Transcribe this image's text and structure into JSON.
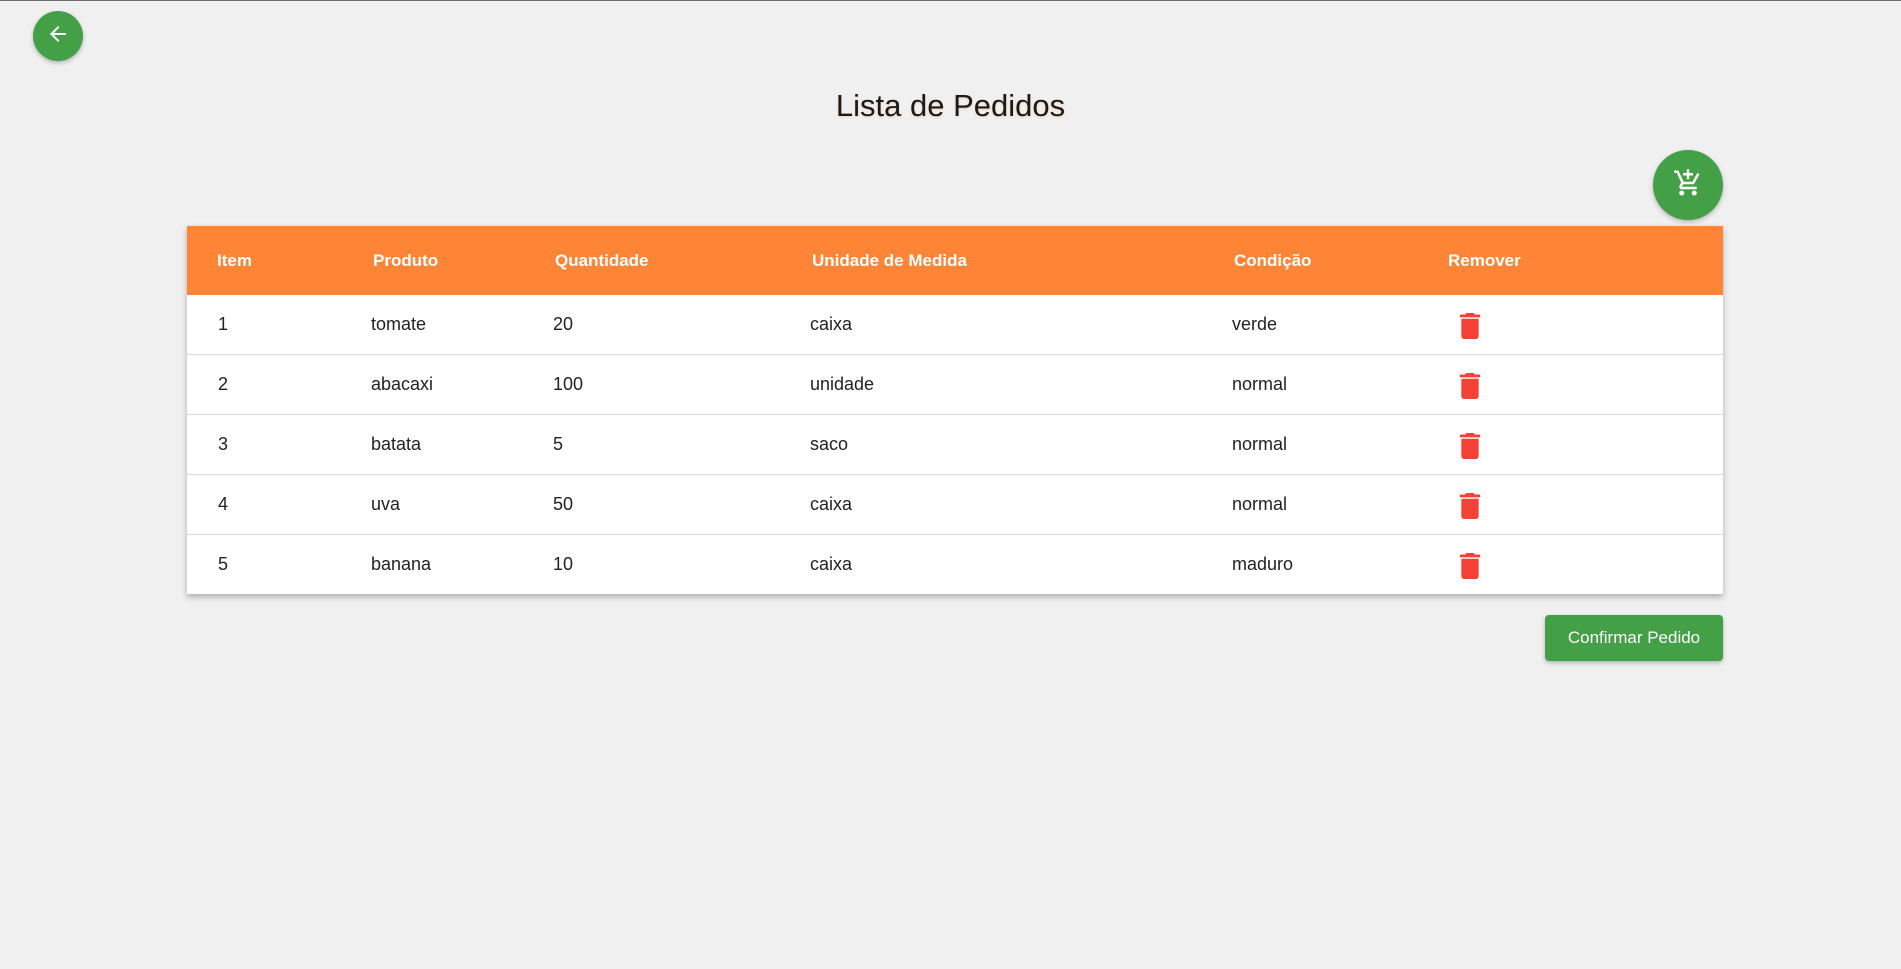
{
  "page": {
    "title": "Lista de Pedidos"
  },
  "icons": {
    "back": "arrow-left-icon",
    "add_cart": "add-shopping-cart-icon",
    "remove": "trash-icon"
  },
  "colors": {
    "primary_green": "#43a047",
    "header_orange": "#ff8536",
    "delete_red": "#f44336",
    "background": "#f0f0f0"
  },
  "table": {
    "headers": {
      "item": "Item",
      "produto": "Produto",
      "quantidade": "Quantidade",
      "unidade": "Unidade de Medida",
      "condicao": "Condição",
      "remover": "Remover"
    },
    "rows": [
      {
        "item": "1",
        "produto": "tomate",
        "quantidade": "20",
        "unidade": "caixa",
        "condicao": "verde"
      },
      {
        "item": "2",
        "produto": "abacaxi",
        "quantidade": "100",
        "unidade": "unidade",
        "condicao": "normal"
      },
      {
        "item": "3",
        "produto": "batata",
        "quantidade": "5",
        "unidade": "saco",
        "condicao": "normal"
      },
      {
        "item": "4",
        "produto": "uva",
        "quantidade": "50",
        "unidade": "caixa",
        "condicao": "normal"
      },
      {
        "item": "5",
        "produto": "banana",
        "quantidade": "10",
        "unidade": "caixa",
        "condicao": "maduro"
      }
    ]
  },
  "actions": {
    "confirm_label": "Confirmar Pedido"
  }
}
